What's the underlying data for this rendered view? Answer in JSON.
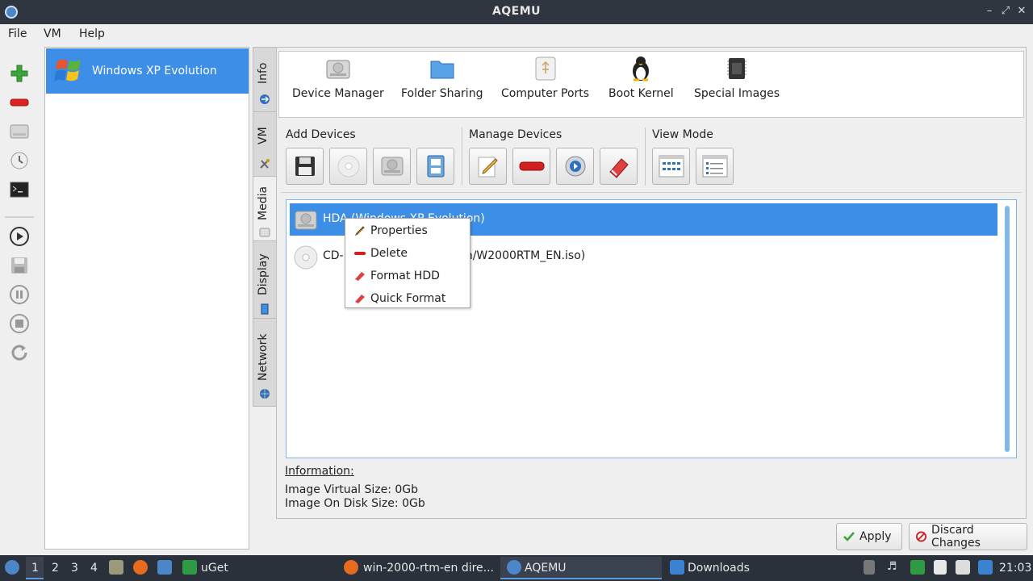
{
  "window": {
    "title": "AQEMU"
  },
  "menu": {
    "file": "File",
    "vm": "VM",
    "help": "Help"
  },
  "left_toolbar": [
    "add-vm-icon",
    "remove-vm-icon",
    "hdd-icon",
    "clock-icon",
    "terminal-icon",
    "play-icon",
    "save-icon",
    "pause-icon",
    "stop-icon",
    "reset-icon"
  ],
  "vm_list": {
    "items": [
      {
        "name": "Windows XP Evolution"
      }
    ]
  },
  "tabs": {
    "info": "Info",
    "vm": "VM",
    "media": "Media",
    "display": "Display",
    "network": "Network"
  },
  "top_tools": {
    "device_manager": "Device Manager",
    "folder_sharing": "Folder Sharing",
    "computer_ports": "Computer Ports",
    "boot_kernel": "Boot Kernel",
    "special_images": "Special Images"
  },
  "groups": {
    "add_devices": "Add Devices",
    "manage_devices": "Manage Devices",
    "view_mode": "View Mode"
  },
  "devices": {
    "hda": "HDA (Windows XP Evolution)",
    "cdrom": "CD-ROM (win-2000-rtm-en/W2000RTM_EN.iso)"
  },
  "context_menu": {
    "properties": "Properties",
    "delete": "Delete",
    "format_hdd": "Format HDD",
    "quick_format": "Quick Format"
  },
  "information": {
    "heading": "Information:",
    "virtual_size": "Image Virtual Size: 0Gb",
    "disk_size": "Image On Disk Size: 0Gb"
  },
  "buttons": {
    "apply": "Apply",
    "discard": "Discard Changes"
  },
  "taskbar": {
    "workspaces": [
      "1",
      "2",
      "3",
      "4"
    ],
    "uget": "uGet",
    "firefox_window": "win-2000-rtm-en dire...",
    "aqemu_window": "AQEMU",
    "downloads": "Downloads",
    "clock": "21:03"
  },
  "colors": {
    "selection": "#3d8ee6",
    "titlebar": "#2f3640",
    "taskbar": "#2b313a"
  }
}
